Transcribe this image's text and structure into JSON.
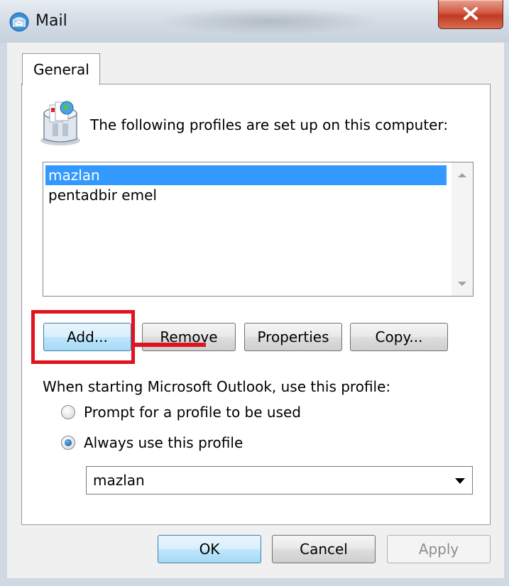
{
  "window": {
    "title": "Mail"
  },
  "tabs": [
    {
      "label": "General"
    }
  ],
  "intro_text": "The following profiles are set up on this computer:",
  "profiles": [
    {
      "name": "mazlan",
      "selected": true
    },
    {
      "name": "pentadbir emel",
      "selected": false
    }
  ],
  "profile_buttons": {
    "add": "Add...",
    "remove": "Remove",
    "properties": "Properties",
    "copy": "Copy..."
  },
  "startup": {
    "label": "When starting Microsoft Outlook, use this profile:",
    "options": [
      {
        "label": "Prompt for a profile to be used",
        "checked": false
      },
      {
        "label": "Always use this profile",
        "checked": true
      }
    ],
    "selected_profile": "mazlan"
  },
  "dialog_buttons": {
    "ok": "OK",
    "cancel": "Cancel",
    "apply": "Apply"
  },
  "colors": {
    "highlight": "#e0141e",
    "selection": "#3399ff",
    "close_button": "#c03a22"
  },
  "icons": {
    "app": "mail-icon",
    "profiles": "mail-profiles-icon",
    "close": "close-icon"
  }
}
